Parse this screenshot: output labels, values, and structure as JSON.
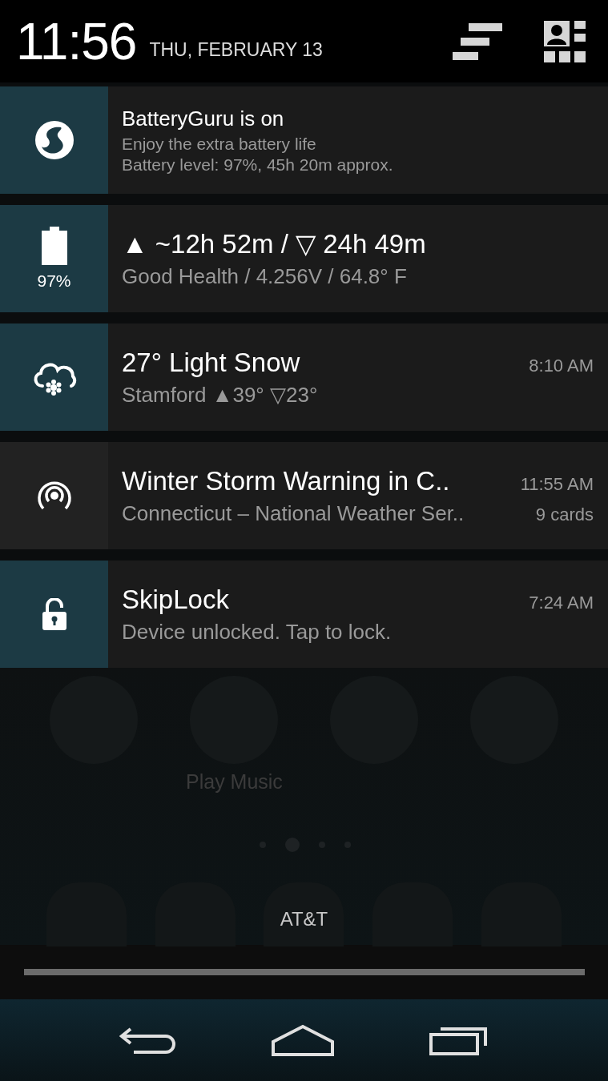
{
  "header": {
    "time": "11:56",
    "date": "THU, FEBRUARY 13"
  },
  "notifications": [
    {
      "kind": "batteryguru",
      "color": "#1c3a44",
      "title": "BatteryGuru is on",
      "lines": [
        "Enjoy the extra battery life",
        "Battery level: 97%, 45h 20m approx."
      ]
    },
    {
      "kind": "battery",
      "color": "#1c3a44",
      "icon_label": "97%",
      "title": "▲ ~12h 52m  / ▽ 24h 49m",
      "lines": [
        "Good Health / 4.256V / 64.8° F"
      ]
    },
    {
      "kind": "weather",
      "color": "#1c3a44",
      "title": "27° Light Snow",
      "time": "8:10 AM",
      "lines": [
        "Stamford  ▲39° ▽23°"
      ]
    },
    {
      "kind": "alert",
      "color": "#222222",
      "title": "Winter Storm Warning in C..",
      "time": "11:55 AM",
      "lines": [
        "Connecticut – National Weather Ser.."
      ],
      "count": "9 cards"
    },
    {
      "kind": "lock",
      "color": "#1c3a44",
      "title": "SkipLock",
      "time": "7:24 AM",
      "lines": [
        "Device unlocked. Tap to lock."
      ]
    }
  ],
  "home_screen": {
    "app_label": "Play Music",
    "carrier": "AT&T"
  }
}
